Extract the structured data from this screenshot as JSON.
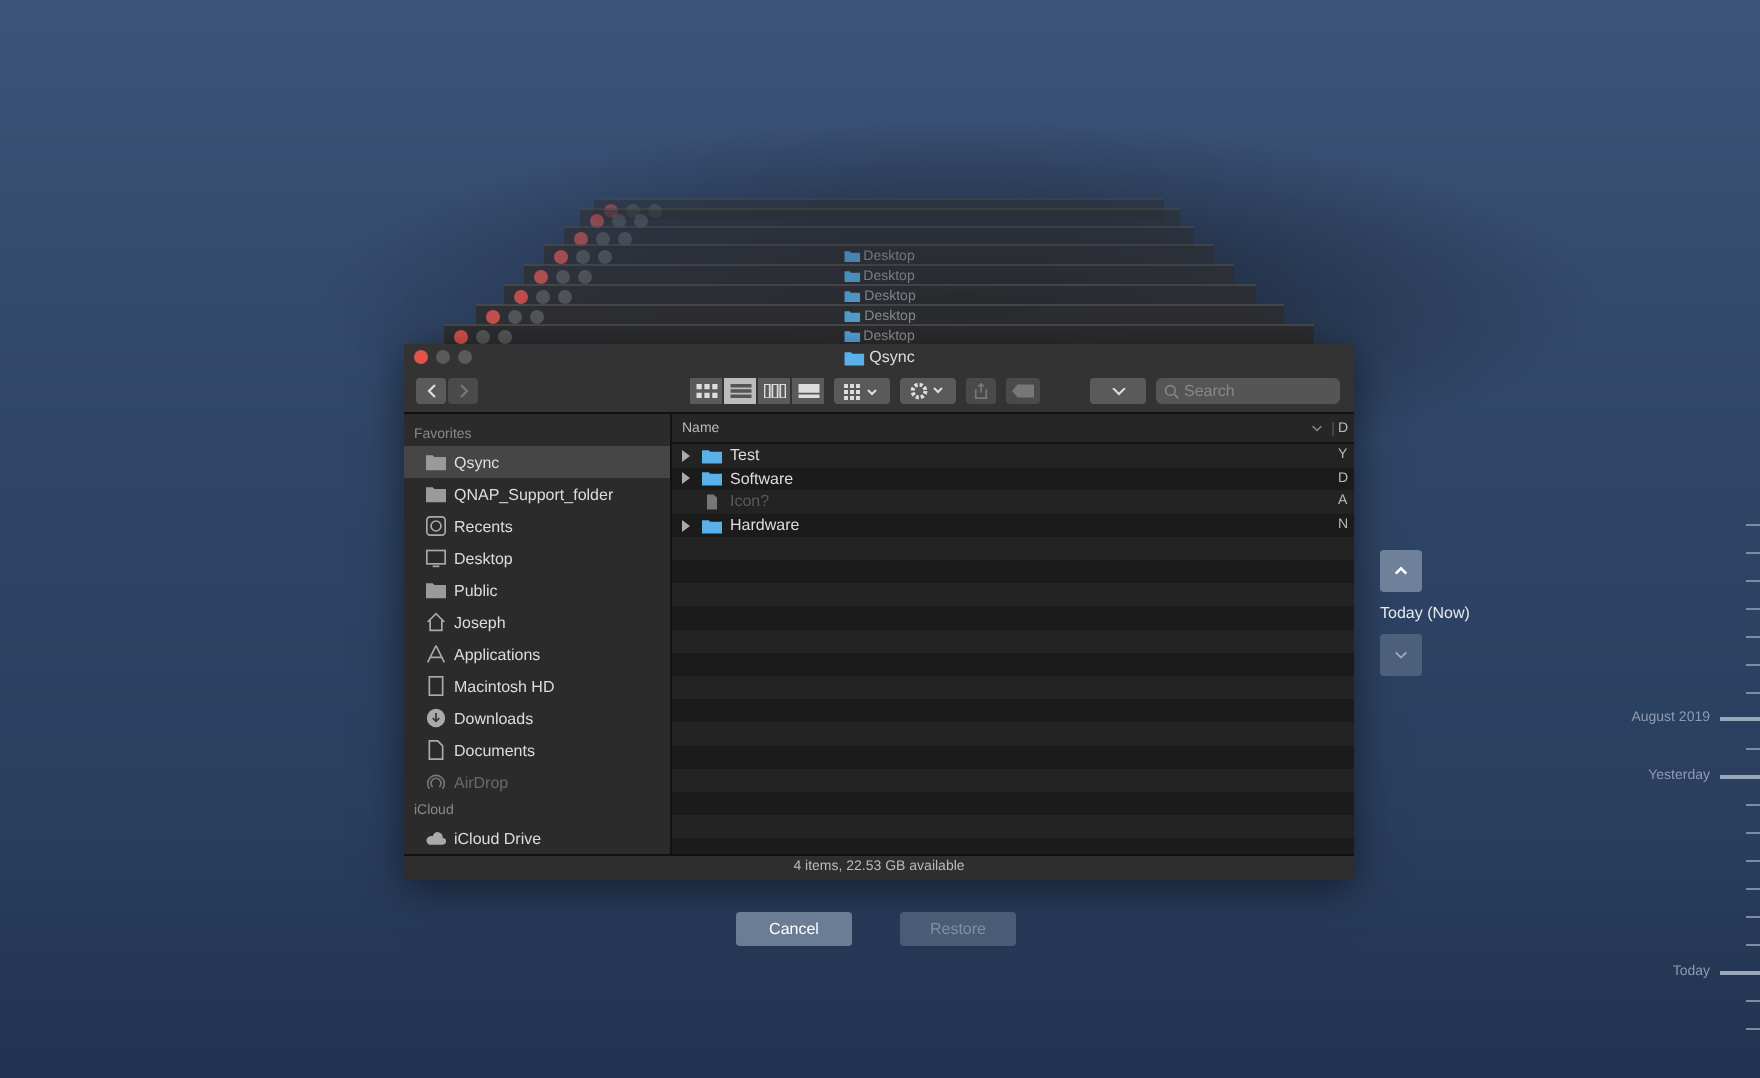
{
  "back_windows": [
    {
      "title": "Desktop"
    },
    {
      "title": "Desktop"
    },
    {
      "title": "Desktop"
    },
    {
      "title": "Desktop"
    },
    {
      "title": "Desktop"
    }
  ],
  "window": {
    "title": "Qsync"
  },
  "toolbar": {
    "views": [
      {
        "selected": false
      },
      {
        "selected": true
      },
      {
        "selected": false
      },
      {
        "selected": false
      }
    ],
    "search": {
      "placeholder": "Search"
    }
  },
  "sidebar": {
    "sections": [
      {
        "heading": "Favorites",
        "items": [
          {
            "label": "Qsync",
            "kind": "folder",
            "selected": true,
            "disabled": false
          },
          {
            "label": "QNAP_Support_folder",
            "kind": "folder",
            "selected": false,
            "disabled": false
          },
          {
            "label": "Recents",
            "kind": "clock",
            "selected": false,
            "disabled": false
          },
          {
            "label": "Desktop",
            "kind": "desktop",
            "selected": false,
            "disabled": false
          },
          {
            "label": "Public",
            "kind": "folder",
            "selected": false,
            "disabled": false
          },
          {
            "label": "Joseph",
            "kind": "home",
            "selected": false,
            "disabled": false
          },
          {
            "label": "Applications",
            "kind": "apps",
            "selected": false,
            "disabled": false
          },
          {
            "label": "Macintosh HD",
            "kind": "disk",
            "selected": false,
            "disabled": false
          },
          {
            "label": "Downloads",
            "kind": "download",
            "selected": false,
            "disabled": false
          },
          {
            "label": "Documents",
            "kind": "document",
            "selected": false,
            "disabled": false
          },
          {
            "label": "AirDrop",
            "kind": "airdrop",
            "selected": false,
            "disabled": true
          }
        ]
      },
      {
        "heading": "iCloud",
        "items": [
          {
            "label": "iCloud Drive",
            "kind": "cloud",
            "selected": false,
            "disabled": false
          }
        ]
      }
    ]
  },
  "table": {
    "columns": [
      "Name",
      "D"
    ],
    "rows": [
      {
        "name": "Test",
        "kind": "folder",
        "disabled": false,
        "column_2": "Y"
      },
      {
        "name": "Software",
        "kind": "folder",
        "disabled": false,
        "column_2": "D"
      },
      {
        "name": "Icon?",
        "kind": "file",
        "disabled": true,
        "column_2": "A"
      },
      {
        "name": "Hardware",
        "kind": "folder",
        "disabled": false,
        "column_2": "N"
      }
    ]
  },
  "status_bar": "4 items, 22.53 GB available",
  "buttons": [
    {
      "label": "Cancel",
      "disabled": false
    },
    {
      "label": "Restore",
      "disabled": true
    }
  ],
  "navigator": {
    "label": "Today (Now)"
  },
  "timeline": [
    {
      "label": "August 2019"
    },
    {
      "label": "Yesterday"
    },
    {
      "label": "Today"
    }
  ]
}
